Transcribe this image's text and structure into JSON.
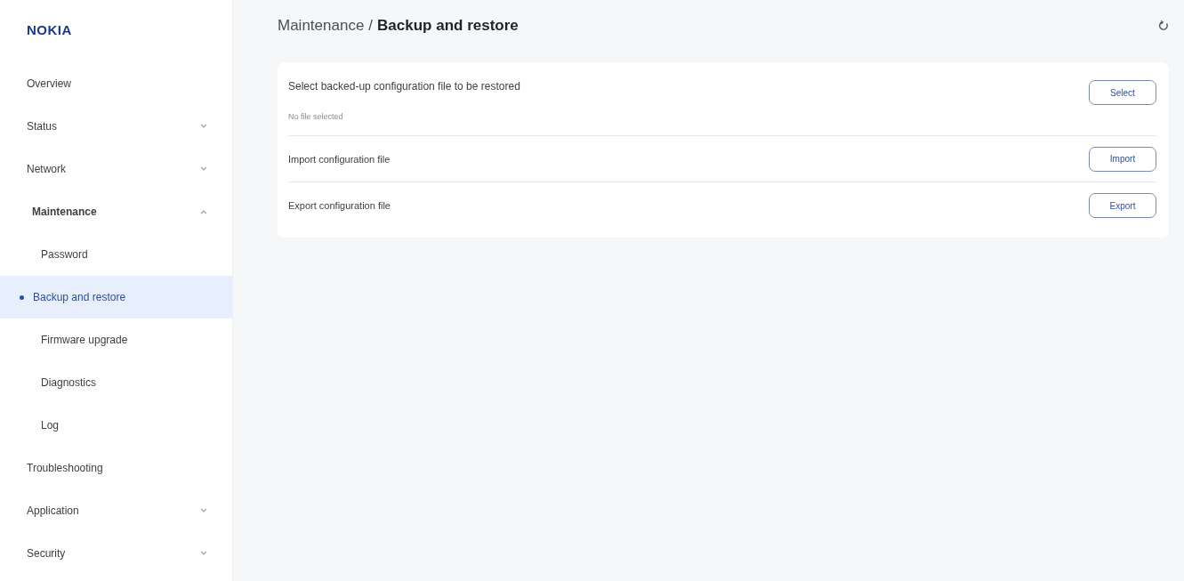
{
  "brand": {
    "logo": "NOKIA"
  },
  "sidebar": {
    "items": [
      {
        "label": "Overview",
        "kind": "link",
        "selected": false
      },
      {
        "label": "Status",
        "kind": "group",
        "expanded": false,
        "selected": false
      },
      {
        "label": "Network",
        "kind": "group",
        "expanded": false,
        "selected": false
      },
      {
        "label": "Maintenance",
        "kind": "group",
        "expanded": true,
        "selected": false,
        "children": [
          {
            "label": "Password",
            "selected": false
          },
          {
            "label": "Backup and restore",
            "selected": true
          },
          {
            "label": "Firmware upgrade",
            "selected": false
          },
          {
            "label": "Diagnostics",
            "selected": false
          },
          {
            "label": "Log",
            "selected": false
          }
        ]
      },
      {
        "label": "Troubleshooting",
        "kind": "link",
        "selected": false
      },
      {
        "label": "Application",
        "kind": "group",
        "expanded": false,
        "selected": false
      },
      {
        "label": "Security",
        "kind": "group",
        "expanded": false,
        "selected": false
      }
    ]
  },
  "header": {
    "breadcrumb_parent": "Maintenance",
    "separator": "/",
    "title": "Backup and restore"
  },
  "card": {
    "rows": [
      {
        "label": "Select backed-up configuration file to be restored",
        "note": "No file selected",
        "button": "Select"
      },
      {
        "label": "Import configuration file",
        "button": "Import"
      },
      {
        "label": "Export configuration file",
        "button": "Export"
      }
    ]
  }
}
